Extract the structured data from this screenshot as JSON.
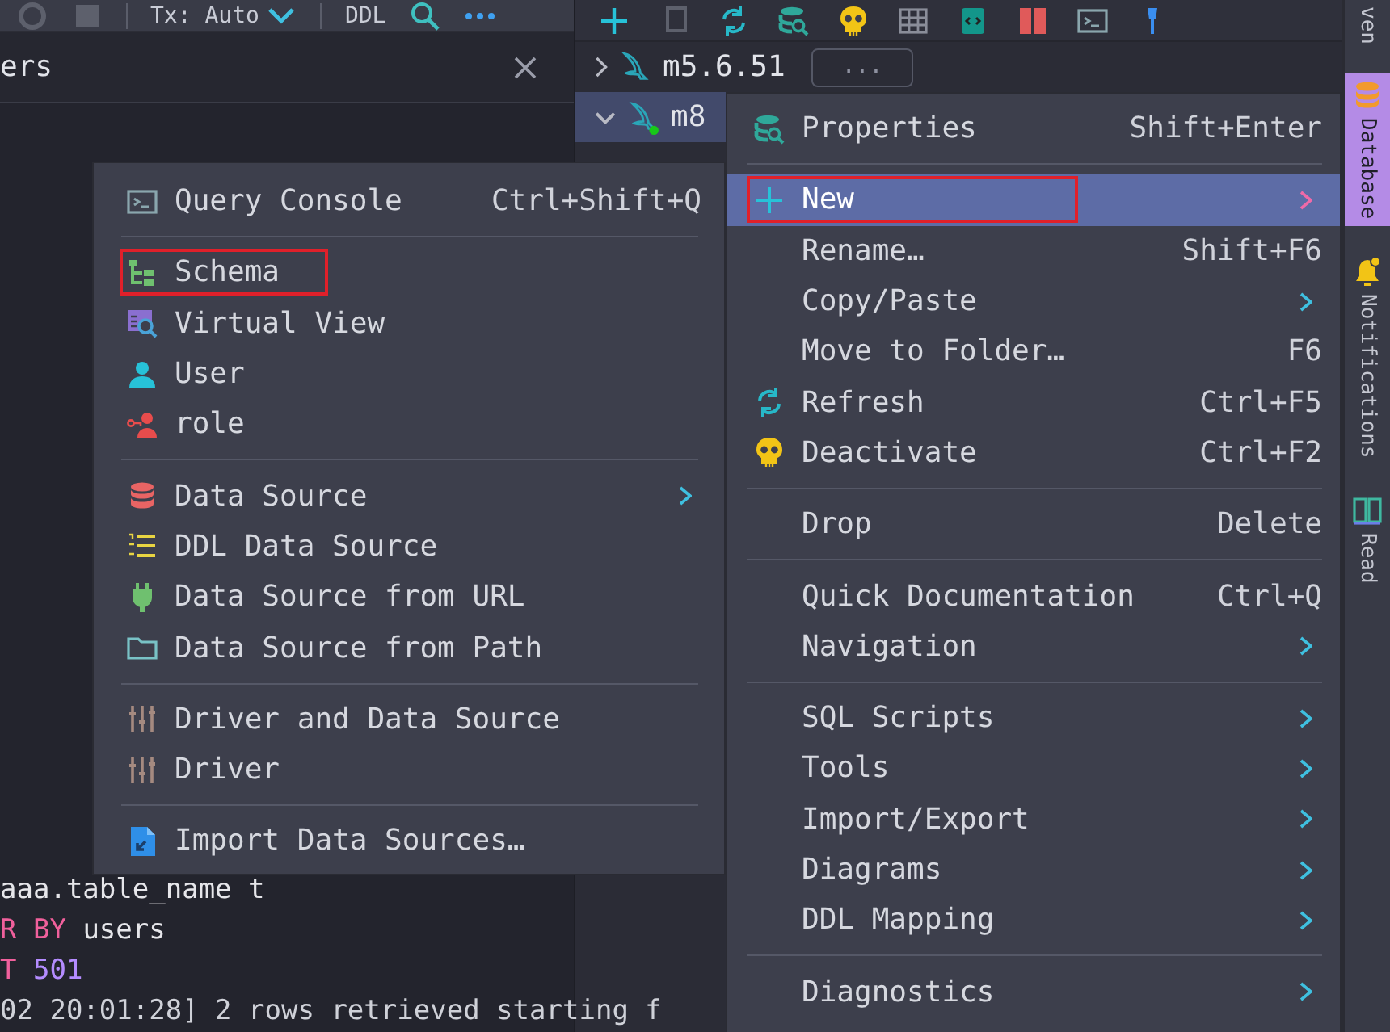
{
  "editor_toolbar": {
    "transaction": "Tx: Auto",
    "ddl": "DDL"
  },
  "editor_tab": {
    "title": "ers"
  },
  "editor_lines": [
    {
      "tokens": [
        {
          "text": "aaa.table_name t",
          "kind": "plain"
        }
      ]
    },
    {
      "tokens": [
        {
          "text": "R BY",
          "kind": "keyword"
        },
        {
          "text": " users",
          "kind": "plain"
        }
      ]
    },
    {
      "tokens": [
        {
          "text": "T",
          "kind": "keyword"
        },
        {
          "text": " 501",
          "kind": "number"
        }
      ]
    },
    {
      "tokens": [
        {
          "text": "02 20:01:28] 2 rows retrieved starting f",
          "kind": "log"
        }
      ]
    }
  ],
  "database_tree": [
    {
      "label": "m5.6.51",
      "expanded": false,
      "connected": false,
      "selected": false,
      "badge": "..."
    },
    {
      "label": "m8",
      "expanded": true,
      "connected": true,
      "selected": true
    }
  ],
  "tool_stripe": [
    {
      "label": "ven",
      "kind": "plain",
      "selected": false
    },
    {
      "label": "Database",
      "kind": "database",
      "selected": true
    },
    {
      "label": "Notifications",
      "kind": "bell",
      "selected": false
    },
    {
      "label": "Read",
      "kind": "book",
      "selected": false
    }
  ],
  "context_menu": {
    "groups": [
      {
        "items": [
          {
            "label": "Properties",
            "kind": "properties",
            "shortcut": "Shift+Enter",
            "submenu": false,
            "selected": false,
            "annotated": false
          }
        ]
      },
      {
        "items": [
          {
            "label": "New",
            "kind": "plus",
            "submenu": true,
            "selected": true,
            "annotated": true
          },
          {
            "label": "Rename…",
            "kind": "none",
            "shortcut": "Shift+F6",
            "submenu": false,
            "selected": false,
            "annotated": false
          },
          {
            "label": "Copy/Paste",
            "kind": "none",
            "submenu": true,
            "selected": false,
            "annotated": false
          },
          {
            "label": "Move to Folder…",
            "kind": "none",
            "shortcut": "F6",
            "submenu": false,
            "selected": false,
            "annotated": false
          },
          {
            "label": "Refresh",
            "kind": "refresh",
            "shortcut": "Ctrl+F5",
            "submenu": false,
            "selected": false,
            "annotated": false
          },
          {
            "label": "Deactivate",
            "kind": "skull",
            "shortcut": "Ctrl+F2",
            "submenu": false,
            "selected": false,
            "annotated": false
          }
        ]
      },
      {
        "items": [
          {
            "label": "Drop",
            "kind": "none",
            "shortcut": "Delete",
            "submenu": false,
            "selected": false,
            "annotated": false
          }
        ]
      },
      {
        "items": [
          {
            "label": "Quick Documentation",
            "kind": "none",
            "shortcut": "Ctrl+Q",
            "submenu": false,
            "selected": false,
            "annotated": false
          },
          {
            "label": "Navigation",
            "kind": "none",
            "submenu": true,
            "selected": false,
            "annotated": false
          }
        ]
      },
      {
        "items": [
          {
            "label": "SQL Scripts",
            "kind": "none",
            "submenu": true,
            "selected": false,
            "annotated": false
          },
          {
            "label": "Tools",
            "kind": "none",
            "submenu": true,
            "selected": false,
            "annotated": false
          },
          {
            "label": "Import/Export",
            "kind": "none",
            "submenu": true,
            "selected": false,
            "annotated": false
          },
          {
            "label": "Diagrams",
            "kind": "none",
            "submenu": true,
            "selected": false,
            "annotated": false
          },
          {
            "label": "DDL Mapping",
            "kind": "none",
            "submenu": true,
            "selected": false,
            "annotated": false
          }
        ]
      },
      {
        "items": [
          {
            "label": "Diagnostics",
            "kind": "none",
            "submenu": true,
            "selected": false,
            "annotated": false
          }
        ]
      }
    ]
  },
  "new_submenu": {
    "groups": [
      {
        "items": [
          {
            "label": "Query Console",
            "kind": "console",
            "shortcut": "Ctrl+Shift+Q",
            "submenu": false,
            "annotated": false
          }
        ]
      },
      {
        "items": [
          {
            "label": "Schema",
            "kind": "schema",
            "submenu": false,
            "annotated": true
          },
          {
            "label": "Virtual View",
            "kind": "virtual-view",
            "submenu": false,
            "annotated": false
          },
          {
            "label": "User",
            "kind": "user",
            "submenu": false,
            "annotated": false
          },
          {
            "label": "role",
            "kind": "role",
            "submenu": false,
            "annotated": false
          }
        ]
      },
      {
        "items": [
          {
            "label": "Data Source",
            "kind": "data-source",
            "submenu": true,
            "annotated": false
          },
          {
            "label": "DDL Data Source",
            "kind": "ddl",
            "submenu": false,
            "annotated": false
          },
          {
            "label": "Data Source from URL",
            "kind": "plug",
            "submenu": false,
            "annotated": false
          },
          {
            "label": "Data Source from Path",
            "kind": "folder",
            "submenu": false,
            "annotated": false
          }
        ]
      },
      {
        "items": [
          {
            "label": "Driver and Data Source",
            "kind": "driver",
            "submenu": false,
            "annotated": false
          },
          {
            "label": "Driver",
            "kind": "driver",
            "submenu": false,
            "annotated": false
          }
        ]
      },
      {
        "items": [
          {
            "label": "Import Data Sources…",
            "kind": "import",
            "submenu": false,
            "annotated": false
          }
        ]
      }
    ]
  }
}
